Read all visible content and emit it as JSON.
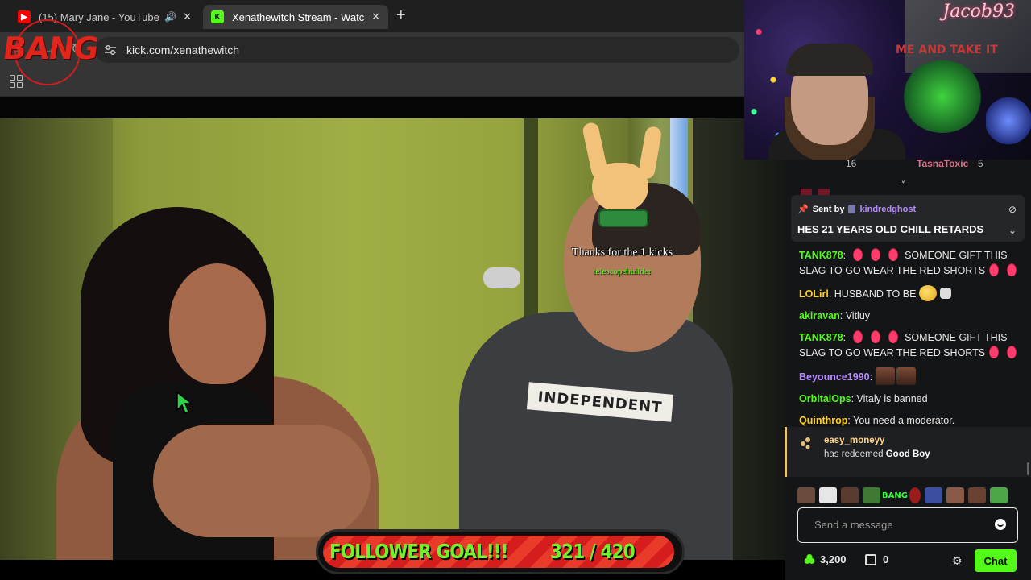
{
  "browser": {
    "tabs": [
      {
        "title": "(15) Mary Jane - YouTube",
        "icon": "youtube-icon",
        "audio": true,
        "active": false
      },
      {
        "title": "Xenathewitch Stream - Watch Li",
        "icon": "kick-icon",
        "audio": false,
        "active": true
      }
    ],
    "new_tab_label": "+",
    "address": "kick.com/xenathewitch"
  },
  "overlay_logo": {
    "text": "BANG",
    "color": "#e1251b"
  },
  "video": {
    "alert_message": "Thanks for the 1 kicks",
    "alert_user": "telescopebuilder",
    "shirt_print": "INDEPENDENT",
    "goal_label": "FOLLOWER GOAL!!!",
    "goal_count": "321 / 420",
    "goal_fraction": 0.764
  },
  "webcam": {
    "name": "Jacob93",
    "sign_text": "ME AND TAKE IT"
  },
  "chat": {
    "top_line": {
      "count_a": "16",
      "user_b": "TasnaToxic",
      "count_c": "5"
    },
    "pinned": {
      "sent_by_label": "Sent by",
      "sender": "kindredghost",
      "text": "HES 21 YEARS OLD CHILL RETARDS"
    },
    "messages": [
      {
        "user": "TANK878",
        "color": "#53fc18",
        "text": "SOMEONE GIFT THIS SLAG TO GO WEAR THE RED SHORTS",
        "lips_before": 3,
        "lips_after": 2
      },
      {
        "user": "LOLirl",
        "color": "#ffd21f",
        "text": "HUSBAND TO BE",
        "emote": "dog"
      },
      {
        "user": "akiravan",
        "color": "#53fc18",
        "text": "Vitluy"
      },
      {
        "user": "TANK878",
        "color": "#53fc18",
        "text": "SOMEONE GIFT THIS SLAG TO GO WEAR THE RED SHORTS",
        "lips_before": 3,
        "lips_after": 2
      },
      {
        "user": "Beyounce1990",
        "color": "#b58cff",
        "text": "",
        "emote": "faces"
      },
      {
        "user": "OrbitalOps",
        "color": "#53fc18",
        "text": "Vitaly is banned"
      },
      {
        "user": "Quinthrop",
        "color": "#ffd21f",
        "text": "You need a moderator."
      }
    ],
    "redeem": {
      "user": "easy_moneyy",
      "prefix": "has redeemed",
      "reward": "Good Boy"
    },
    "emote_bar": {
      "bang_label": "BANG"
    },
    "input_placeholder": "Send a message",
    "points": "3,200",
    "gifts": "0",
    "chat_button": "Chat"
  }
}
